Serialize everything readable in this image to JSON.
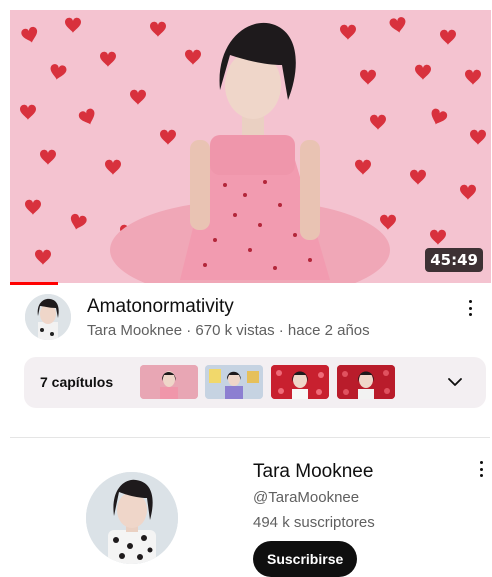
{
  "video": {
    "duration": "45:49",
    "title": "Amatonormativity",
    "meta": "Tara Mooknee · 670 k vistas · hace 2 años",
    "progress_fraction": 0.1
  },
  "chapters": {
    "label": "7 capítulos"
  },
  "channel": {
    "name": "Tara Mooknee",
    "handle": "@TaraMooknee",
    "subscribers": "494 k suscriptores",
    "subscribe_label": "Suscribirse"
  },
  "icons": {
    "video_menu": "more-vert-icon",
    "channel_menu": "more-vert-icon",
    "expand": "chevron-down-icon"
  },
  "colors": {
    "progress": "#ff0000",
    "thumbnail_pink": "#f2b6c6",
    "heart_red": "#d8313d",
    "subscribe_bg": "#0f0f0f"
  }
}
